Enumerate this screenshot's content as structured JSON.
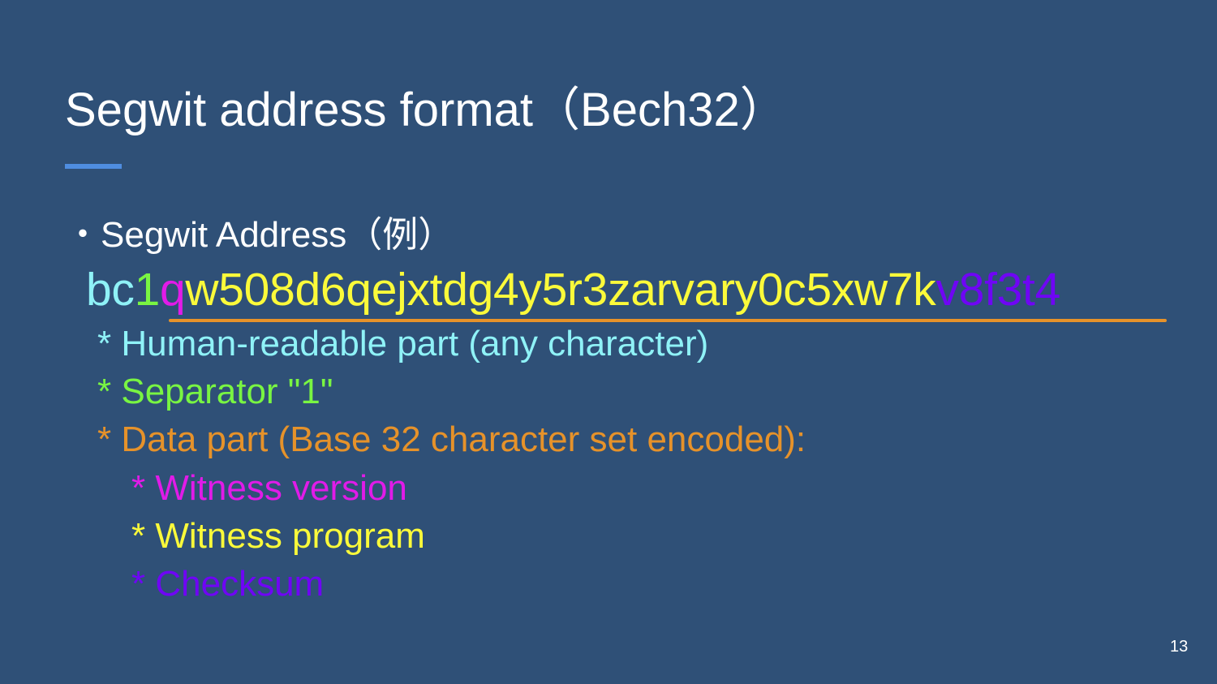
{
  "slide": {
    "title": "Segwit address format（Bech32）",
    "subheading": "・Segwit Address（例）",
    "address": {
      "hrp": "bc",
      "separator": "1",
      "witness_version": "q",
      "witness_program": "w508d6qejxtdg4y5r3zarvary0c5xw7k",
      "checksum": "v8f3t4"
    },
    "lines": [
      "* Human-readable part (any character)",
      "* Separator \"1\"",
      "* Data part (Base 32 character set encoded):",
      "* Witness version",
      "* Witness program",
      "* Checksum"
    ],
    "page_number": "13"
  },
  "colors": {
    "background": "#2f5077",
    "title_text": "#ffffff",
    "title_rule": "#4f8de0",
    "hrp": "#8ff2f7",
    "separator": "#79f542",
    "data_part": "#e6922a",
    "witness_version": "#e11be8",
    "witness_program": "#fbfa3a",
    "checksum": "#6f05f5"
  }
}
